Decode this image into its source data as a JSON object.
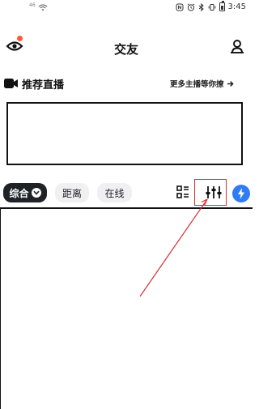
{
  "status_bar": {
    "signal": "46",
    "time": "3:45"
  },
  "header": {
    "title": "交友",
    "left_icon": "eye-icon",
    "right_icon": "profile-location-icon"
  },
  "live": {
    "title": "推荐直播",
    "more_label": "更多主播等你撩",
    "icon": "video-camera-icon"
  },
  "tabs": [
    {
      "label": "综合",
      "selected": true
    },
    {
      "label": "距离",
      "selected": false
    },
    {
      "label": "在线",
      "selected": false
    }
  ],
  "toolbar": {
    "grid_icon": "list-grid-icon",
    "filter_icon": "sliders-icon",
    "bolt_icon": "lightning-icon"
  },
  "colors": {
    "accent_dark": "#1f2328",
    "notify_dot": "#ff5a3c",
    "bolt_blue": "#2e7cf6",
    "annotation_red": "#d93030"
  }
}
